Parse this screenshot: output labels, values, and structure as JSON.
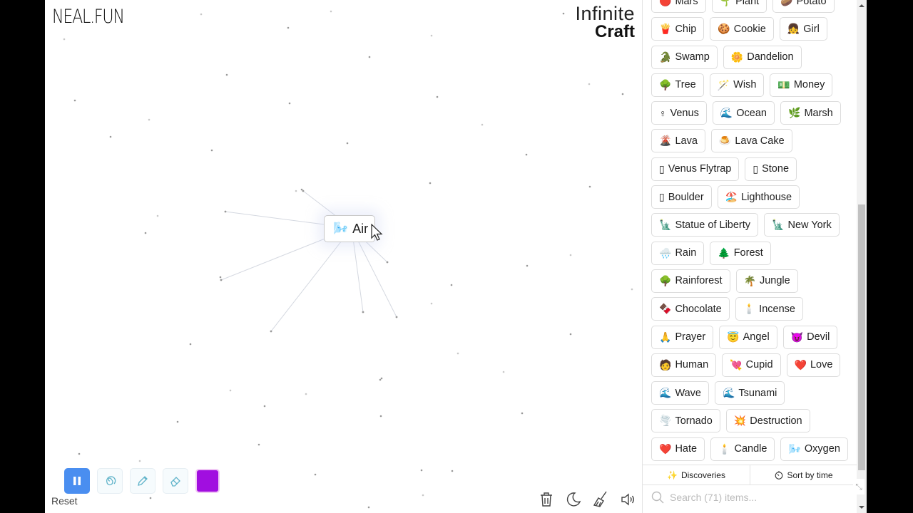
{
  "branding": {
    "site_logo": "NEAL.FUN",
    "game_title_line1": "Infinite",
    "game_title_line2": "Craft"
  },
  "canvas": {
    "instances": [
      {
        "emoji": "🌬️",
        "label": "Air",
        "icon": "wind-face-icon"
      }
    ]
  },
  "toolbar": {
    "pause_icon": "pause-icon",
    "reset_label": "Reset",
    "tools": [
      "spiral-icon",
      "pencil-icon",
      "eraser-icon"
    ],
    "current_color": "#a10ee0",
    "right_icons": [
      "trash-icon",
      "moon-icon",
      "broom-icon",
      "speaker-icon"
    ]
  },
  "sidebar": {
    "items": [
      {
        "emoji": "🔴",
        "label": "Mars"
      },
      {
        "emoji": "🌱",
        "label": "Plant"
      },
      {
        "emoji": "🥔",
        "label": "Potato"
      },
      {
        "emoji": "🍟",
        "label": "Chip"
      },
      {
        "emoji": "🍪",
        "label": "Cookie"
      },
      {
        "emoji": "👧",
        "label": "Girl"
      },
      {
        "emoji": "🐊",
        "label": "Swamp"
      },
      {
        "emoji": "🌼",
        "label": "Dandelion"
      },
      {
        "emoji": "🌳",
        "label": "Tree"
      },
      {
        "emoji": "🪄",
        "label": "Wish"
      },
      {
        "emoji": "💵",
        "label": "Money"
      },
      {
        "emoji": "♀",
        "label": "Venus"
      },
      {
        "emoji": "🌊",
        "label": "Ocean"
      },
      {
        "emoji": "🌿",
        "label": "Marsh"
      },
      {
        "emoji": "🌋",
        "label": "Lava"
      },
      {
        "emoji": "🍮",
        "label": "Lava Cake"
      },
      {
        "emoji": "▯",
        "label": "Venus Flytrap"
      },
      {
        "emoji": "▯",
        "label": "Stone"
      },
      {
        "emoji": "▯",
        "label": "Boulder"
      },
      {
        "emoji": "🏖️",
        "label": "Lighthouse"
      },
      {
        "emoji": "🗽",
        "label": "Statue of Liberty"
      },
      {
        "emoji": "🗽",
        "label": "New York"
      },
      {
        "emoji": "🌧️",
        "label": "Rain"
      },
      {
        "emoji": "🌲",
        "label": "Forest"
      },
      {
        "emoji": "🌳",
        "label": "Rainforest"
      },
      {
        "emoji": "🌴",
        "label": "Jungle"
      },
      {
        "emoji": "🍫",
        "label": "Chocolate"
      },
      {
        "emoji": "🕯️",
        "label": "Incense"
      },
      {
        "emoji": "🙏",
        "label": "Prayer"
      },
      {
        "emoji": "😇",
        "label": "Angel"
      },
      {
        "emoji": "😈",
        "label": "Devil"
      },
      {
        "emoji": "🧑",
        "label": "Human"
      },
      {
        "emoji": "💘",
        "label": "Cupid"
      },
      {
        "emoji": "❤️",
        "label": "Love"
      },
      {
        "emoji": "🌊",
        "label": "Wave"
      },
      {
        "emoji": "🌊",
        "label": "Tsunami"
      },
      {
        "emoji": "🌪️",
        "label": "Tornado"
      },
      {
        "emoji": "💥",
        "label": "Destruction"
      },
      {
        "emoji": "❤️",
        "label": "Hate"
      },
      {
        "emoji": "🕯️",
        "label": "Candle"
      },
      {
        "emoji": "🌬️",
        "label": "Oxygen"
      }
    ],
    "footer": {
      "discoveries_label": "Discoveries",
      "sort_label": "Sort by time",
      "search_placeholder": "Search (71) items..."
    }
  }
}
